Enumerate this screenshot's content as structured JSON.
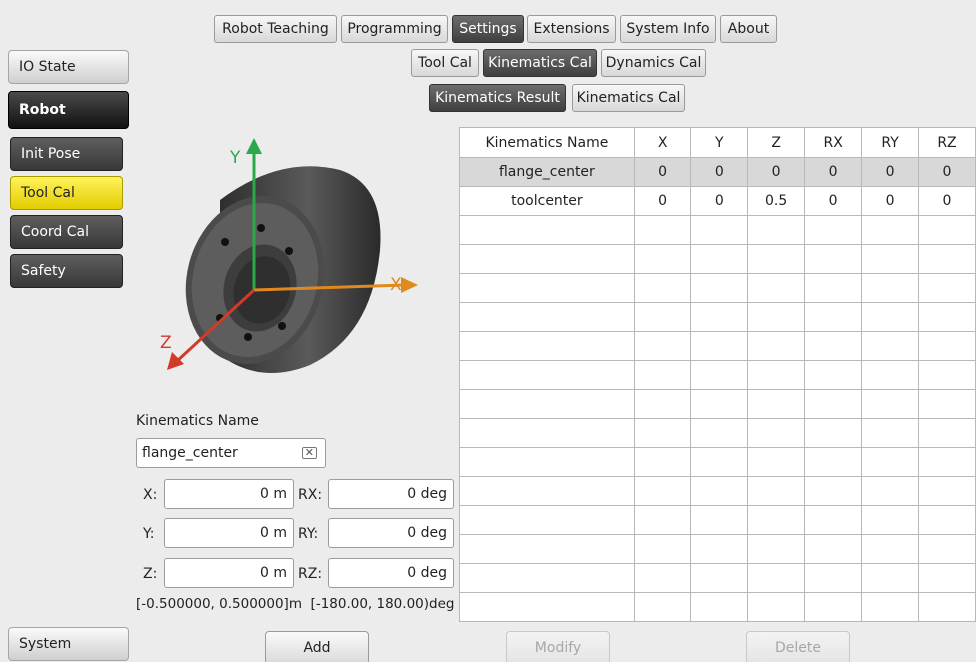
{
  "top_tabs": [
    "Robot Teaching",
    "Programming",
    "Settings",
    "Extensions",
    "System Info",
    "About"
  ],
  "settings_tabs": [
    "Tool Cal",
    "Kinematics Cal",
    "Dynamics Cal"
  ],
  "kinematics_tabs": [
    "Kinematics Result",
    "Kinematics Cal"
  ],
  "sidebar": {
    "io_state": "IO State",
    "robot": "Robot",
    "items": [
      "Init Pose",
      "Tool Cal",
      "Coord Cal",
      "Safety"
    ],
    "system": "System"
  },
  "diagram": {
    "y_axis": "Y",
    "x_axis": "X",
    "z_axis": "Z",
    "colors": {
      "y": "#2aa84a",
      "x": "#e08a1e",
      "z": "#d23a2a"
    }
  },
  "form": {
    "name_label": "Kinematics Name",
    "name_value": "flange_center",
    "x_label": "X:",
    "x_value": "0 m",
    "y_label": "Y:",
    "y_value": "0 m",
    "z_label": "Z:",
    "z_value": "0 m",
    "rx_label": "RX:",
    "rx_value": "0 deg",
    "ry_label": "RY:",
    "ry_value": "0 deg",
    "rz_label": "RZ:",
    "rz_value": "0 deg",
    "range_text": "[-0.500000, 0.500000]m  [-180.00, 180.00)deg"
  },
  "table": {
    "columns": [
      "Kinematics Name",
      "X",
      "Y",
      "Z",
      "RX",
      "RY",
      "RZ"
    ],
    "rows": [
      [
        "flange_center",
        "0",
        "0",
        "0",
        "0",
        "0",
        "0"
      ],
      [
        "toolcenter",
        "0",
        "0",
        "0.5",
        "0",
        "0",
        "0"
      ]
    ],
    "empty_rows": 14
  },
  "actions": {
    "add": "Add",
    "modify": "Modify",
    "delete": "Delete"
  }
}
